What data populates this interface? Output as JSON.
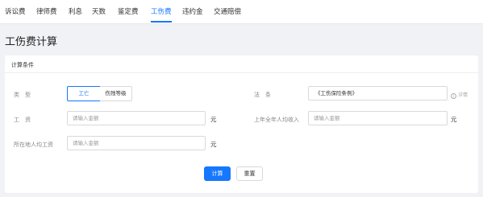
{
  "tabs": [
    {
      "label": "诉讼费",
      "active": false
    },
    {
      "label": "律师费",
      "active": false
    },
    {
      "label": "利息",
      "active": false
    },
    {
      "label": "天数",
      "active": false
    },
    {
      "label": "鉴定费",
      "active": false
    },
    {
      "label": "工伤费",
      "active": true
    },
    {
      "label": "违约金",
      "active": false
    },
    {
      "label": "交通赔偿",
      "active": false
    }
  ],
  "page": {
    "title": "工伤费计算"
  },
  "card": {
    "title": "计算条件"
  },
  "form": {
    "type_label": "类　型",
    "type_options": [
      {
        "label": "工亡",
        "selected": true
      },
      {
        "label": "伤残等级",
        "selected": false
      }
    ],
    "law_label": "法　条",
    "law_value": "《工伤保险条例》",
    "detail_label": "详情",
    "wage_label": "工　资",
    "wage_placeholder": "请输入金额",
    "wage_unit": "元",
    "annual_income_label": "上年全年人均收入",
    "annual_income_placeholder": "请输入金额",
    "annual_income_unit": "元",
    "local_wage_label": "所在地人均工资",
    "local_wage_placeholder": "请输入金额",
    "local_wage_unit": "元"
  },
  "actions": {
    "calculate_label": "计算",
    "reset_label": "重置"
  },
  "colors": {
    "accent": "#1677ff",
    "background": "#f0f2f5"
  }
}
